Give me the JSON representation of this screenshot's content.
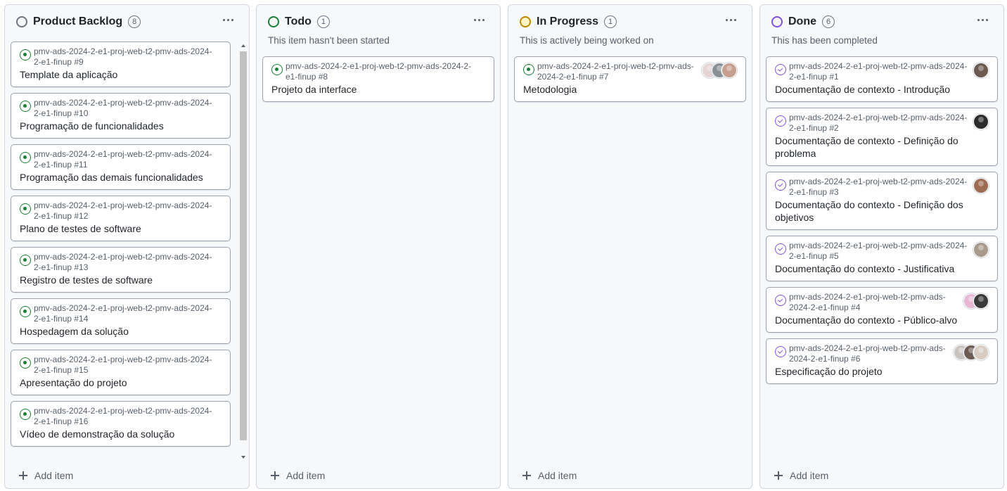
{
  "columns": [
    {
      "title": "Product Backlog",
      "count": "8",
      "status_color": "#6e7781",
      "description": "",
      "add_label": "Add item",
      "cards": [
        {
          "ref": "pmv-ads-2024-2-e1-proj-web-t2-pmv-ads-2024-2-e1-finup #9",
          "title": "Template da aplicação",
          "avatars": []
        },
        {
          "ref": "pmv-ads-2024-2-e1-proj-web-t2-pmv-ads-2024-2-e1-finup #10",
          "title": "Programação de funcionalidades",
          "avatars": []
        },
        {
          "ref": "pmv-ads-2024-2-e1-proj-web-t2-pmv-ads-2024-2-e1-finup #11",
          "title": "Programação das demais funcionalidades",
          "avatars": []
        },
        {
          "ref": "pmv-ads-2024-2-e1-proj-web-t2-pmv-ads-2024-2-e1-finup #12",
          "title": "Plano de testes de software",
          "avatars": []
        },
        {
          "ref": "pmv-ads-2024-2-e1-proj-web-t2-pmv-ads-2024-2-e1-finup #13",
          "title": "Registro de testes de software",
          "avatars": []
        },
        {
          "ref": "pmv-ads-2024-2-e1-proj-web-t2-pmv-ads-2024-2-e1-finup #14",
          "title": "Hospedagem da solução",
          "avatars": []
        },
        {
          "ref": "pmv-ads-2024-2-e1-proj-web-t2-pmv-ads-2024-2-e1-finup #15",
          "title": "Apresentação do projeto",
          "avatars": []
        },
        {
          "ref": "pmv-ads-2024-2-e1-proj-web-t2-pmv-ads-2024-2-e1-finup #16",
          "title": "Vídeo de demonstração da solução",
          "avatars": []
        }
      ]
    },
    {
      "title": "Todo",
      "count": "1",
      "status_color": "#1a7f37",
      "description": "This item hasn't been started",
      "add_label": "Add item",
      "cards": [
        {
          "ref": "pmv-ads-2024-2-e1-proj-web-t2-pmv-ads-2024-2-e1-finup #8",
          "title": "Projeto da interface",
          "avatars": []
        }
      ]
    },
    {
      "title": "In Progress",
      "count": "1",
      "status_color": "#bf8700",
      "description": "This is actively being worked on",
      "add_label": "Add item",
      "cards": [
        {
          "ref": "pmv-ads-2024-2-e1-proj-web-t2-pmv-ads-2024-2-e1-finup #7",
          "title": "Metodologia",
          "avatars": [
            "#e6d3d3",
            "#8a8f96",
            "#c79f8e"
          ]
        }
      ]
    },
    {
      "title": "Done",
      "count": "6",
      "status_color": "#8250df",
      "description": "This has been completed",
      "add_label": "Add item",
      "cards": [
        {
          "ref": "pmv-ads-2024-2-e1-proj-web-t2-pmv-ads-2024-2-e1-finup #1",
          "title": "Documentação de contexto - Introdução",
          "avatars": [
            "#6b5a4f"
          ]
        },
        {
          "ref": "pmv-ads-2024-2-e1-proj-web-t2-pmv-ads-2024-2-e1-finup #2",
          "title": "Documentação de contexto - Definição do problema",
          "avatars": [
            "#2b2b2b"
          ]
        },
        {
          "ref": "pmv-ads-2024-2-e1-proj-web-t2-pmv-ads-2024-2-e1-finup #3",
          "title": "Documentação do contexto - Definição dos objetivos",
          "avatars": [
            "#9c6b52"
          ]
        },
        {
          "ref": "pmv-ads-2024-2-e1-proj-web-t2-pmv-ads-2024-2-e1-finup #5",
          "title": "Documentação do contexto - Justificativa",
          "avatars": [
            "#a89a8c"
          ]
        },
        {
          "ref": "pmv-ads-2024-2-e1-proj-web-t2-pmv-ads-2024-2-e1-finup #4",
          "title": "Documentação do contexto - Público-alvo",
          "avatars": [
            "#e8b7d4",
            "#3a3a3a"
          ]
        },
        {
          "ref": "pmv-ads-2024-2-e1-proj-web-t2-pmv-ads-2024-2-e1-finup #6",
          "title": "Especificação do projeto",
          "avatars": [
            "#c9c4c0",
            "#6d5a52",
            "#d7cbc2"
          ]
        }
      ]
    }
  ]
}
